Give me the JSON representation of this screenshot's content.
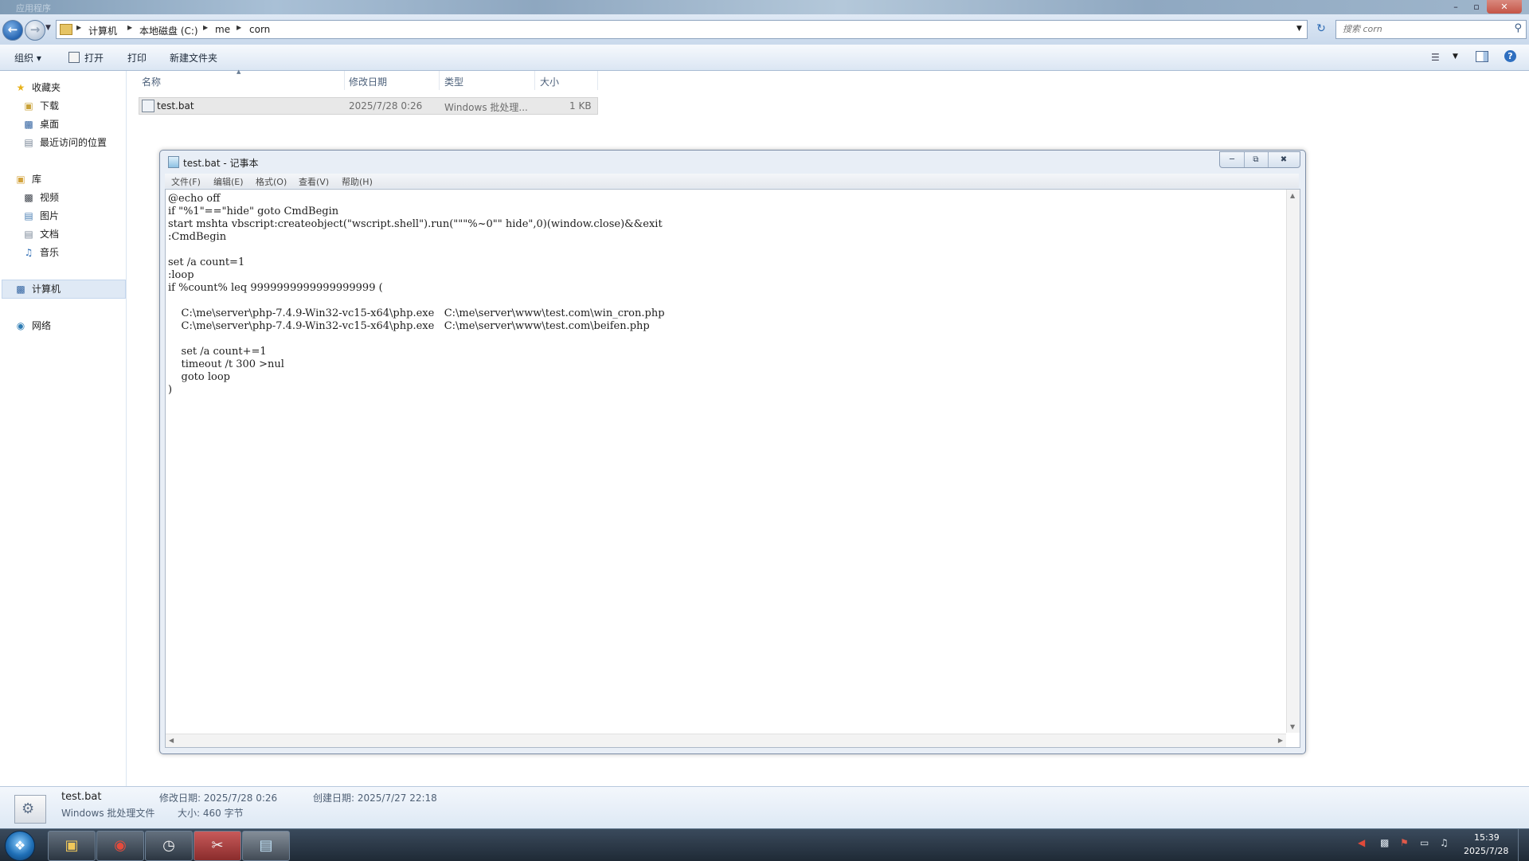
{
  "explorer": {
    "title": "应用程序",
    "window_controls": {
      "minimize": "–",
      "maximize": "▫",
      "close": "✕"
    },
    "address": {
      "crumbs": [
        "计算机",
        "本地磁盘 (C:)",
        "me",
        "corn"
      ]
    },
    "search_placeholder": "搜索 corn",
    "toolbar": {
      "organize": "组织 ▾",
      "open": "打开",
      "print": "打印",
      "new_folder": "新建文件夹"
    },
    "nav": {
      "favorites": "收藏夹",
      "downloads": "下载",
      "desktop": "桌面",
      "recent": "最近访问的位置",
      "libraries": "库",
      "videos": "视频",
      "pictures": "图片",
      "documents": "文档",
      "music": "音乐",
      "computer": "计算机",
      "network": "网络"
    },
    "columns": {
      "name": "名称",
      "modified": "修改日期",
      "type": "类型",
      "size": "大小"
    },
    "file": {
      "name": "test.bat",
      "modified": "2025/7/28 0:26",
      "type": "Windows 批处理...",
      "size": "1 KB"
    },
    "details": {
      "name": "test.bat",
      "kind": "Windows 批处理文件",
      "modified": "修改日期: 2025/7/28 0:26",
      "size": "大小: 460 字节",
      "created": "创建日期: 2025/7/27 22:18"
    }
  },
  "notepad": {
    "title": "test.bat - 记事本",
    "menu": {
      "file": "文件(F)",
      "edit": "编辑(E)",
      "format": "格式(O)",
      "view": "查看(V)",
      "help": "帮助(H)"
    },
    "content": "@echo off\nif \"%1\"==\"hide\" goto CmdBegin\nstart mshta vbscript:createobject(\"wscript.shell\").run(\"\"\"%~0\"\" hide\",0)(window.close)&&exit\n:CmdBegin\n\nset /a count=1\n:loop\nif %count% leq 9999999999999999999 (\n\n    C:\\me\\server\\php-7.4.9-Win32-vc15-x64\\php.exe   C:\\me\\server\\www\\test.com\\win_cron.php\n    C:\\me\\server\\php-7.4.9-Win32-vc15-x64\\php.exe   C:\\me\\server\\www\\test.com\\beifen.php\n\n    set /a count+=1\n    timeout /t 300 >nul\n    goto loop\n)"
  },
  "taskbar": {
    "apps": [
      "file-explorer-icon",
      "chrome-icon",
      "clock-app-icon",
      "tool-app-icon",
      "notepad-app-icon"
    ],
    "time": "15:39",
    "date": "2025/7/28"
  }
}
